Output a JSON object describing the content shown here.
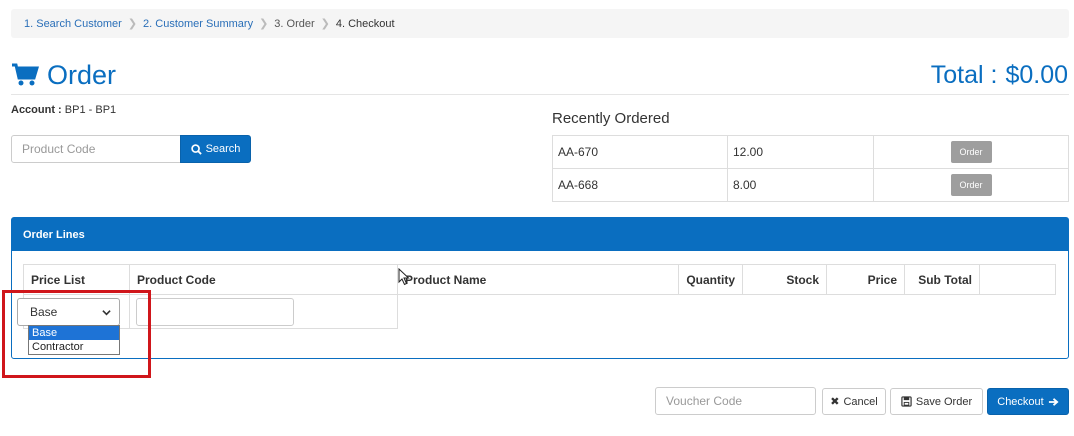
{
  "breadcrumb": [
    {
      "label": "1. Search Customer"
    },
    {
      "label": "2. Customer Summary"
    },
    {
      "label": "3. Order"
    },
    {
      "label": "4. Checkout"
    }
  ],
  "header": {
    "title": "Order",
    "total_label": "Total :",
    "total_value": "$0.00",
    "title_icon": "cart-icon"
  },
  "account": {
    "label": "Account :",
    "value": "BP1 - BP1"
  },
  "search": {
    "placeholder": "Product Code",
    "button_label": "Search",
    "button_icon": "search-icon"
  },
  "recent": {
    "title": "Recently Ordered",
    "rows": [
      {
        "code": "AA-670",
        "qty": "12.00",
        "button": "Order"
      },
      {
        "code": "AA-668",
        "qty": "8.00",
        "button": "Order"
      }
    ]
  },
  "order_lines": {
    "title": "Order Lines",
    "columns": [
      "Price List",
      "Product Code",
      "Product Name",
      "Quantity",
      "Stock",
      "Price",
      "Sub Total",
      ""
    ],
    "price_list_selected": "Base",
    "price_list_options": [
      "Base",
      "Contractor"
    ]
  },
  "footer": {
    "voucher_placeholder": "Voucher Code",
    "cancel_label": "Cancel",
    "save_label": "Save Order",
    "checkout_label": "Checkout"
  },
  "colors": {
    "primary": "#0a6ec0",
    "highlight": "#d0161b",
    "order_button": "#9e9e9e"
  }
}
